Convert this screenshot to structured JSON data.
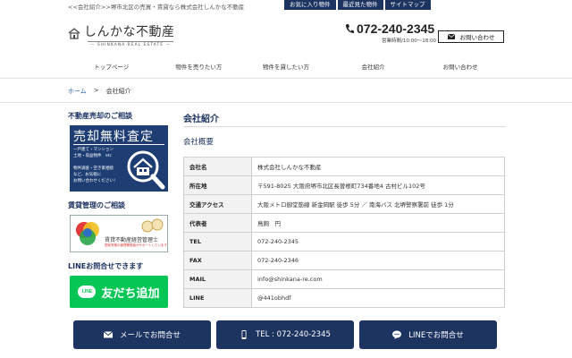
{
  "header": {
    "tagline": "<<会社紹介>>堺市北区の売買・賃貸なら株式会社しんかな不動産",
    "top_links": [
      "お気に入り物件",
      "最近見た物件",
      "サイトマップ"
    ],
    "logo_main": "しんかな不動産",
    "logo_sub": "— SHINKANA REAL ESTATE —",
    "phone": "072-240-2345",
    "hours": "営業時間/10:00〜18:00",
    "contact_label": "お問い合わせ"
  },
  "nav": {
    "items": [
      "トップページ",
      "物件を売りたい方",
      "物件を貸したい方",
      "会社紹介",
      "お問い合わせ"
    ]
  },
  "breadcrumb": {
    "home": "ホーム",
    "sep": ">",
    "current": "会社紹介"
  },
  "sidebar": {
    "sell_heading": "不動産売却のご相談",
    "sell_banner_title": "売却無料査定",
    "sell_banner_lines": [
      "一戸建て・マンション",
      "土地・収益物件　etc",
      "物件調査・空き家相続",
      "など、お気軽に",
      "お問い合わせください！"
    ],
    "rent_heading": "賃貸管理のご相談",
    "rent_banner_text": "賃貸不動産経営管理士",
    "rent_banner_small": "国家資格の管理業務者がサポートしています",
    "line_heading": "LINEお問合せできます",
    "line_badge": "LINE",
    "line_button": "友だち追加"
  },
  "main": {
    "page_title": "会社紹介",
    "section_title": "会社概要",
    "rows": [
      {
        "label": "会社名",
        "value": "株式会社しんかな不動産"
      },
      {
        "label": "所在地",
        "value": "〒591-8025 大阪府堺市北区長曽根町734番地4 古村ビル102号"
      },
      {
        "label": "交通アクセス",
        "value": "大阪メトロ御堂筋線 新金岡駅 徒歩 5分 ／ 南海バス 北堺警察署前 徒歩 1分"
      },
      {
        "label": "代表者",
        "value": "鳥飼　円"
      },
      {
        "label": "TEL",
        "value": "072-240-2345"
      },
      {
        "label": "FAX",
        "value": "072-240-2346"
      },
      {
        "label": "MAIL",
        "value": "info@shinkana-re.com"
      },
      {
        "label": "LINE",
        "value": "@441obhdf"
      }
    ]
  },
  "bottom_bar": {
    "mail": "メールでお問合せ",
    "tel": "TEL : 072-240-2345",
    "line": "LINEでお問合せ"
  },
  "colors": {
    "navy": "#1d3461",
    "line_green": "#06c755",
    "banner_blue": "#1d3d73"
  }
}
